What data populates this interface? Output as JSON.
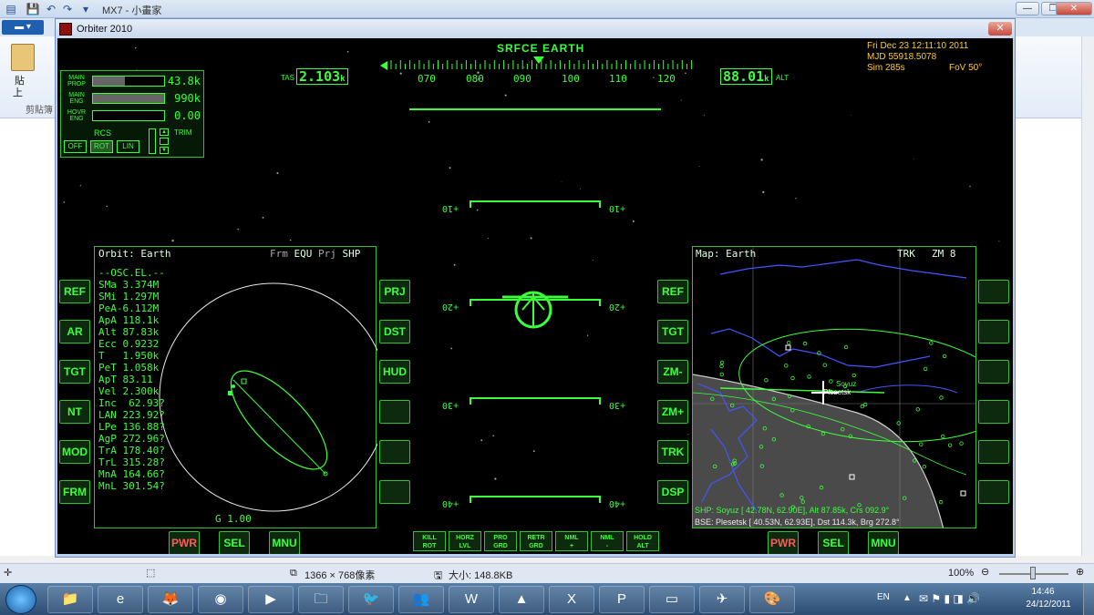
{
  "paint": {
    "title": "MX7 - 小畫家",
    "paste_label": "貼",
    "paste_sub": "上",
    "clipboard_label": "剪貼簿",
    "status_size": "1366 × 768像素",
    "status_filesize": "大小: 148.8KB",
    "zoom": "100%"
  },
  "orbiter": {
    "window_title": "Orbiter 2010",
    "hud_mode": "SRFCE EARTH",
    "tas_label": "TAS",
    "tas_value": "2.103",
    "tas_unit": "k",
    "alt_value": "88.01",
    "alt_unit": "k",
    "alt_label": "ALT",
    "heading_ticks": [
      "070",
      "080",
      "090",
      "100",
      "110",
      "120"
    ],
    "pitch_labels": [
      "+10",
      "+20",
      "+30",
      "+40"
    ],
    "info": {
      "date": "Fri Dec 23 12:11:10 2011",
      "mjd": "MJD 55918.5078",
      "sim": "Sim  285s",
      "fov": "FoV  50°"
    },
    "engines": [
      {
        "label": "MAIN\nPROP",
        "fill": 0.45,
        "value": "43.8k"
      },
      {
        "label": "MAIN\nENG",
        "fill": 1.0,
        "value": "990k"
      },
      {
        "label": "HOVR\nENG",
        "fill": 0.0,
        "value": "0.00"
      }
    ],
    "rcs": {
      "title": "RCS",
      "buttons": [
        "OFF",
        "ROT",
        "LIN"
      ],
      "trim": "TRIM"
    },
    "left_mfd": {
      "title": "Orbit: Earth",
      "frm_label": "Frm",
      "frm": "EQU",
      "prj_label": "Prj",
      "prj": "SHP",
      "lines": [
        "--OSC.EL.--",
        "SMa 3.374M",
        "SMi 1.297M",
        "PeA-6.112M",
        "ApA 118.1k",
        "Alt 87.83k",
        "Ecc 0.9232",
        "T   1.950k",
        "PeT 1.058k",
        "ApT 83.11",
        "Vel 2.300k",
        "Inc  62.93?",
        "LAN 223.92?",
        "LPe 136.88?",
        "AgP 272.96?",
        "TrA 178.40?",
        "TrL 315.28?",
        "MnA 164.66?",
        "MnL 301.54?"
      ],
      "footer": "G 1.00",
      "left_buttons": [
        "REF",
        "AR",
        "TGT",
        "NT",
        "MOD",
        "FRM"
      ],
      "right_buttons": [
        "PRJ",
        "DST",
        "HUD",
        "",
        "",
        ""
      ],
      "bottom_buttons": [
        "PWR",
        "SEL",
        "MNU"
      ]
    },
    "right_mfd": {
      "title": "Map: Earth",
      "trk": "TRK",
      "zoom": "ZM 8",
      "target1": "Soyuz",
      "target2": "Plesetsk",
      "line1": "SHP: Soyuz [ 42.78N, 62.90E], Alt 87.85k, Crs 092.9°",
      "line2": "BSE: Plesetsk [ 40.53N, 62.93E], Dst 114.3k, Brg 272.8°",
      "left_buttons": [
        "REF",
        "TGT",
        "ZM-",
        "ZM+",
        "TRK",
        "DSP"
      ],
      "right_buttons": [
        "",
        "",
        "",
        "",
        "",
        ""
      ],
      "bottom_buttons": [
        "PWR",
        "SEL",
        "MNU"
      ]
    },
    "nav_buttons": [
      {
        "l1": "KILL",
        "l2": "ROT"
      },
      {
        "l1": "HORZ",
        "l2": "LVL"
      },
      {
        "l1": "PRO",
        "l2": "GRD"
      },
      {
        "l1": "RETR",
        "l2": "GRD"
      },
      {
        "l1": "NML",
        "l2": "+"
      },
      {
        "l1": "NML",
        "l2": "-"
      },
      {
        "l1": "HOLD",
        "l2": "ALT"
      }
    ]
  },
  "taskbar": {
    "lang": "EN",
    "time": "14:46",
    "date": "24/12/2011",
    "apps": [
      "explorer-icon",
      "ie-icon",
      "firefox-icon",
      "chrome-icon",
      "media-icon",
      "folder-icon",
      "thunderbird-icon",
      "messenger-icon",
      "word-icon",
      "pdf-icon",
      "excel-icon",
      "powerpoint-icon",
      "notes-icon",
      "orbiter-icon",
      "paint-icon"
    ]
  }
}
